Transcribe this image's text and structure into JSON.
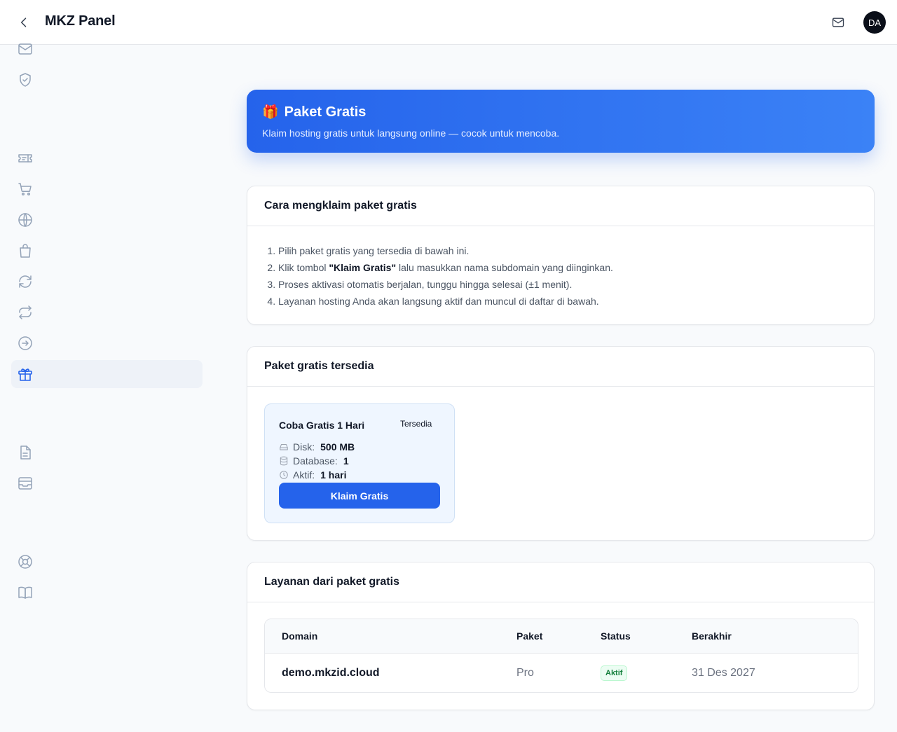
{
  "header": {
    "title": "MKZ Panel",
    "avatar_initials": "DA"
  },
  "sidebar": {
    "icons": [
      "mail-icon",
      "shield-check-icon",
      "ticket-icon",
      "cart-icon",
      "globe-icon",
      "bag-icon",
      "refresh-icon",
      "sync-icon",
      "arrow-right-circle-icon",
      "gift-icon",
      "document-icon",
      "inbox-icon",
      "lifebuoy-icon",
      "book-icon"
    ],
    "active": "gift-icon"
  },
  "hero": {
    "emoji": "🎁",
    "title": "Paket Gratis",
    "subtitle": "Klaim hosting gratis untuk langsung online — cocok untuk mencoba."
  },
  "howto": {
    "title": "Cara mengklaim paket gratis",
    "step1": "Pilih paket gratis yang tersedia di bawah ini.",
    "step2_before": "Klik tombol ",
    "step2_bold": "\"Klaim Gratis\"",
    "step2_after": " lalu masukkan nama subdomain yang diinginkan.",
    "step3": "Proses aktivasi otomatis berjalan, tunggu hingga selesai (±1 menit).",
    "step4": "Layanan hosting Anda akan langsung aktif dan muncul di daftar di bawah."
  },
  "available": {
    "title": "Paket gratis tersedia",
    "plan": {
      "name": "Coba Gratis 1 Hari",
      "badge": "Tersedia",
      "disk_label": "Disk:",
      "disk_value": "500 MB",
      "db_label": "Database:",
      "db_value": "1",
      "active_label": "Aktif:",
      "active_value": "1 hari",
      "button": "Klaim Gratis"
    }
  },
  "services": {
    "title": "Layanan dari paket gratis",
    "columns": [
      "Domain",
      "Paket",
      "Status",
      "Berakhir"
    ],
    "rows": [
      {
        "domain": "demo.mkzid.cloud",
        "paket": "Pro",
        "status": "Aktif",
        "berakhir": "31 Des 2027"
      }
    ]
  },
  "colors": {
    "primary": "#2563eb",
    "success": "#15803d",
    "sidebar_icon": "#94a3b8"
  }
}
